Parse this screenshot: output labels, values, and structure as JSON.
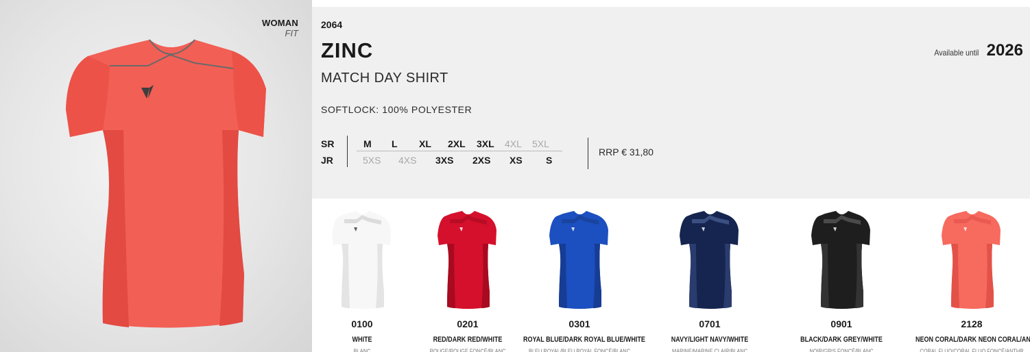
{
  "hero": {
    "fit_label": "WOMAN",
    "fit_sub": "FIT",
    "shirt_color": "#f25f55",
    "shirt_dark": "#e24a42"
  },
  "product": {
    "code": "2064",
    "name": "ZINC",
    "type": "MATCH DAY SHIRT",
    "fabric": "SOFTLOCK: 100% POLYESTER",
    "available_label": "Available until",
    "available_year": "2026",
    "price": "RRP € 31,80"
  },
  "sizes": {
    "sr_label": "SR",
    "jr_label": "JR",
    "sr": [
      {
        "label": "M",
        "available": true
      },
      {
        "label": "L",
        "available": true
      },
      {
        "label": "XL",
        "available": true
      },
      {
        "label": "2XL",
        "available": true
      },
      {
        "label": "3XL",
        "available": true
      },
      {
        "label": "4XL",
        "available": false
      },
      {
        "label": "5XL",
        "available": false
      }
    ],
    "jr": [
      {
        "label": "5XS",
        "available": false
      },
      {
        "label": "4XS",
        "available": false
      },
      {
        "label": "3XS",
        "available": true
      },
      {
        "label": "2XS",
        "available": true
      },
      {
        "label": "XS",
        "available": true
      },
      {
        "label": "S",
        "available": true
      }
    ]
  },
  "variants": [
    {
      "code": "0100",
      "name": "WHITE",
      "sub": "BLANC",
      "body": "#f7f7f7",
      "side": "#e4e4e4",
      "yoke": "#dcdcdc"
    },
    {
      "code": "0201",
      "name": "RED/DARK RED/WHITE",
      "sub": "ROUGE/ROUGE FONCÉ/BLANC",
      "body": "#d4102c",
      "side": "#a80a20",
      "yoke": "#b80d24"
    },
    {
      "code": "0301",
      "name": "ROYAL BLUE/DARK ROYAL BLUE/WHITE",
      "sub": "BLEU ROYAL/BLEU ROYAL FONCÉ/BLANC",
      "body": "#1c4fbf",
      "side": "#163c94",
      "yoke": "#19449f"
    },
    {
      "code": "0701",
      "name": "NAVY/LIGHT NAVY/WHITE",
      "sub": "MARINE/MARINE CLAIR/BLANC",
      "body": "#15254f",
      "side": "#2a3c6e",
      "yoke": "#3b4f82"
    },
    {
      "code": "0901",
      "name": "BLACK/DARK GREY/WHITE",
      "sub": "NOIR/GRIS FONCÉ/BLANC",
      "body": "#1e1e1e",
      "side": "#333333",
      "yoke": "#4a4a4a"
    },
    {
      "code": "2128",
      "name": "NEON CORAL/DARK NEON CORAL/ANTHR",
      "sub": "CORAL FLUO/CORAL FLUO FONCÉ/ANTHR",
      "body": "#f76a5e",
      "side": "#e35248",
      "yoke": "#ea5a50"
    }
  ]
}
